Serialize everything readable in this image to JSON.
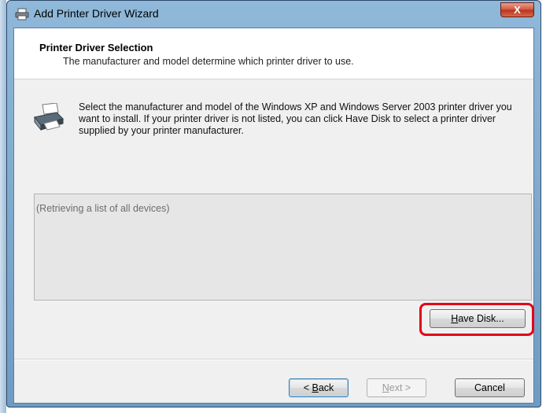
{
  "window": {
    "title": "Add Printer Driver Wizard",
    "close_symbol": "X"
  },
  "header": {
    "title": "Printer Driver Selection",
    "subtitle": "The manufacturer and model determine which printer driver to use."
  },
  "instruction": "Select the manufacturer and model of the Windows XP and Windows Server 2003 printer driver you want to install.  If your printer driver is not listed, you can click Have Disk to select a printer driver supplied by your printer manufacturer.",
  "device_list": {
    "status_text": "(Retrieving a list of all devices)"
  },
  "buttons": {
    "have_disk": {
      "label": "Have Disk...",
      "mnemonic": "H",
      "rest": "ave Disk..."
    },
    "back": {
      "label": "< Back",
      "mnemonic": "B",
      "prefix": "< ",
      "rest": "ack"
    },
    "next": {
      "label": "Next >",
      "mnemonic": "N",
      "rest": "ext >",
      "enabled": false
    },
    "cancel": {
      "label": "Cancel"
    }
  },
  "icons": {
    "title_icon": "printer-icon",
    "page_icon": "printer-icon"
  },
  "colors": {
    "highlight": "#e3001b",
    "close_button": "#c7432a"
  }
}
